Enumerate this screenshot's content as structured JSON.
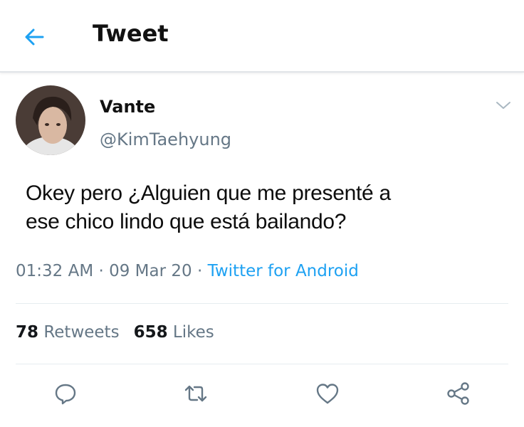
{
  "header": {
    "title": "Tweet"
  },
  "tweet": {
    "display_name": "Vante",
    "handle": "@KimTaehyung",
    "text_line1": "Okey pero ¿Alguien que me presenté a",
    "text_line2": "ese chico lindo que está bailando?",
    "time": "01:32 AM",
    "sep1": " · ",
    "date": "09 Mar 20",
    "sep2": " · ",
    "source": "Twitter for Android"
  },
  "stats": {
    "retweets_count": "78",
    "retweets_label": "Retweets",
    "likes_count": "658",
    "likes_label": "Likes"
  },
  "colors": {
    "accent": "#1da1f2",
    "secondary_text": "#657786",
    "icon": "#657786"
  },
  "icons": [
    "back-arrow-icon",
    "chevron-down-icon",
    "reply-icon",
    "retweet-icon",
    "like-icon",
    "share-icon"
  ]
}
